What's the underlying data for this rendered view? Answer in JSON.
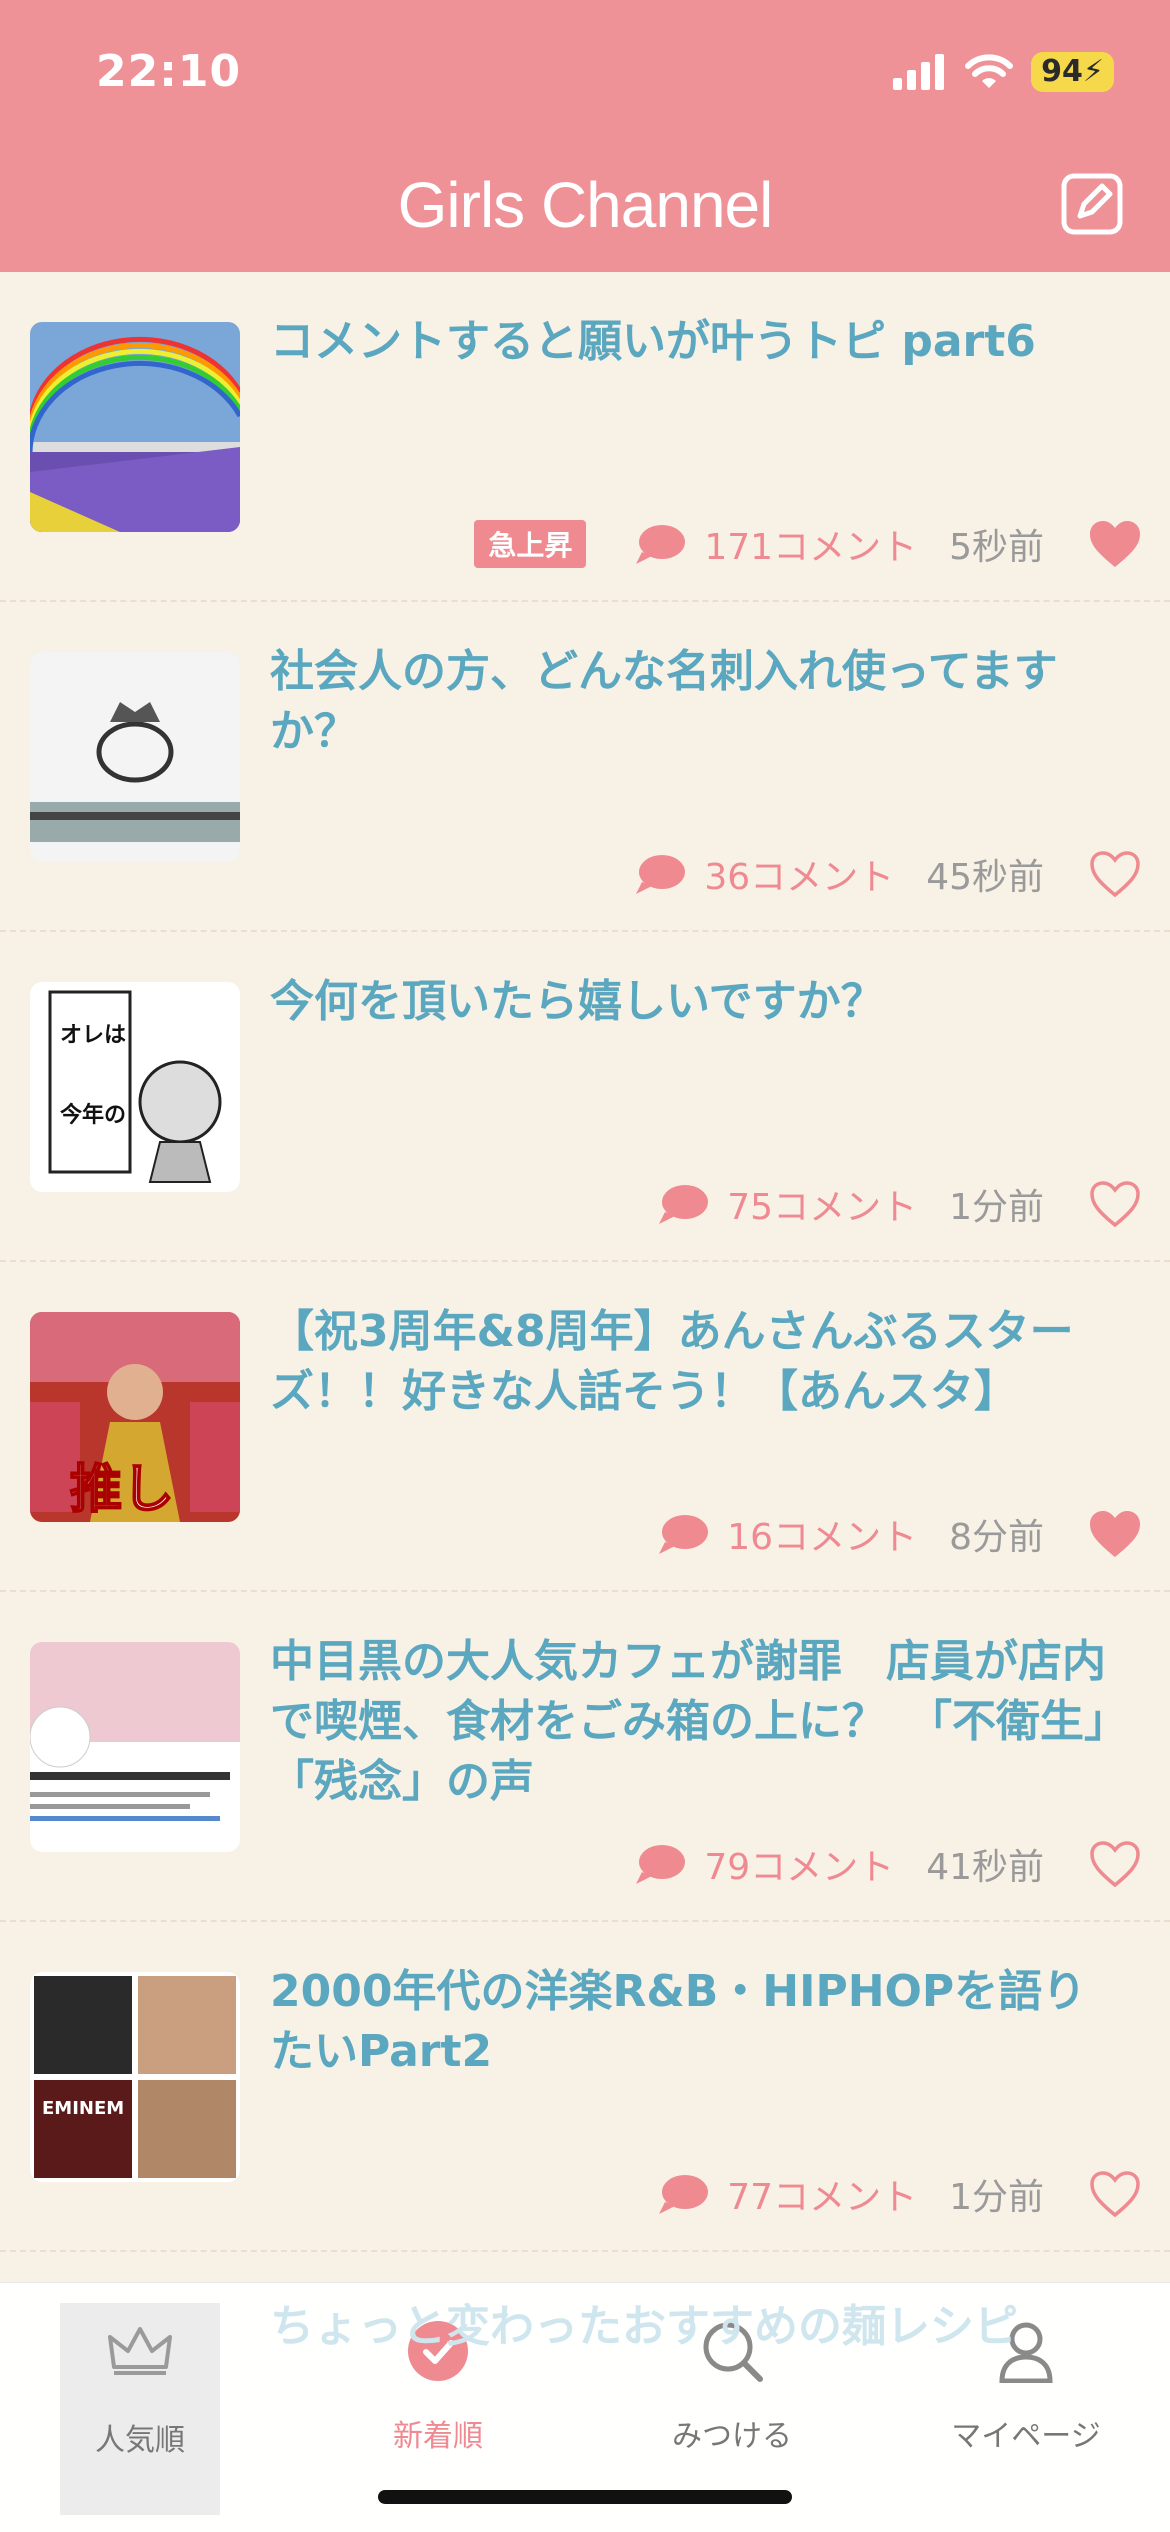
{
  "status": {
    "time": "22:10",
    "battery": "94"
  },
  "header": {
    "title": "Girls Channel"
  },
  "topics": [
    {
      "title": "コメントすると願いが叶うトピ part6",
      "badge": "急上昇",
      "comments": "171コメント",
      "time": "5秒前",
      "liked": true,
      "thumb": "rainbow-lavender"
    },
    {
      "title": "社会人の方、どんな名刺入れ使ってますか？",
      "comments": "36コメント",
      "time": "45秒前",
      "liked": false,
      "thumb": "card-case"
    },
    {
      "title": "今何を頂いたら嬉しいですか？",
      "comments": "75コメント",
      "time": "1分前",
      "liked": false,
      "thumb": "manga"
    },
    {
      "title": "【祝3周年&8周年】あんさんぶるスターズ！！好きな人話そう！【あんスタ】",
      "comments": "16コメント",
      "time": "8分前",
      "liked": true,
      "thumb": "oshi"
    },
    {
      "title": "中目黒の大人気カフェが謝罪　店員が店内で喫煙、食材をごみ箱の上に？　「不衛生」「残念」の声",
      "comments": "79コメント",
      "time": "41秒前",
      "liked": false,
      "thumb": "cafe-tweet"
    },
    {
      "title": "2000年代の洋楽R&B・HIPHOPを語りたいPart2",
      "comments": "77コメント",
      "time": "1分前",
      "liked": false,
      "thumb": "albums"
    }
  ],
  "peek": {
    "title": "ちょっと変わったおすすめの麺レシピ"
  },
  "tabs": {
    "popular": "人気順",
    "new": "新着順",
    "search": "みつける",
    "mypage": "マイページ"
  },
  "colors": {
    "accent": "#ee9297",
    "title": "#5aa7bf",
    "comment": "#ef8a92"
  }
}
